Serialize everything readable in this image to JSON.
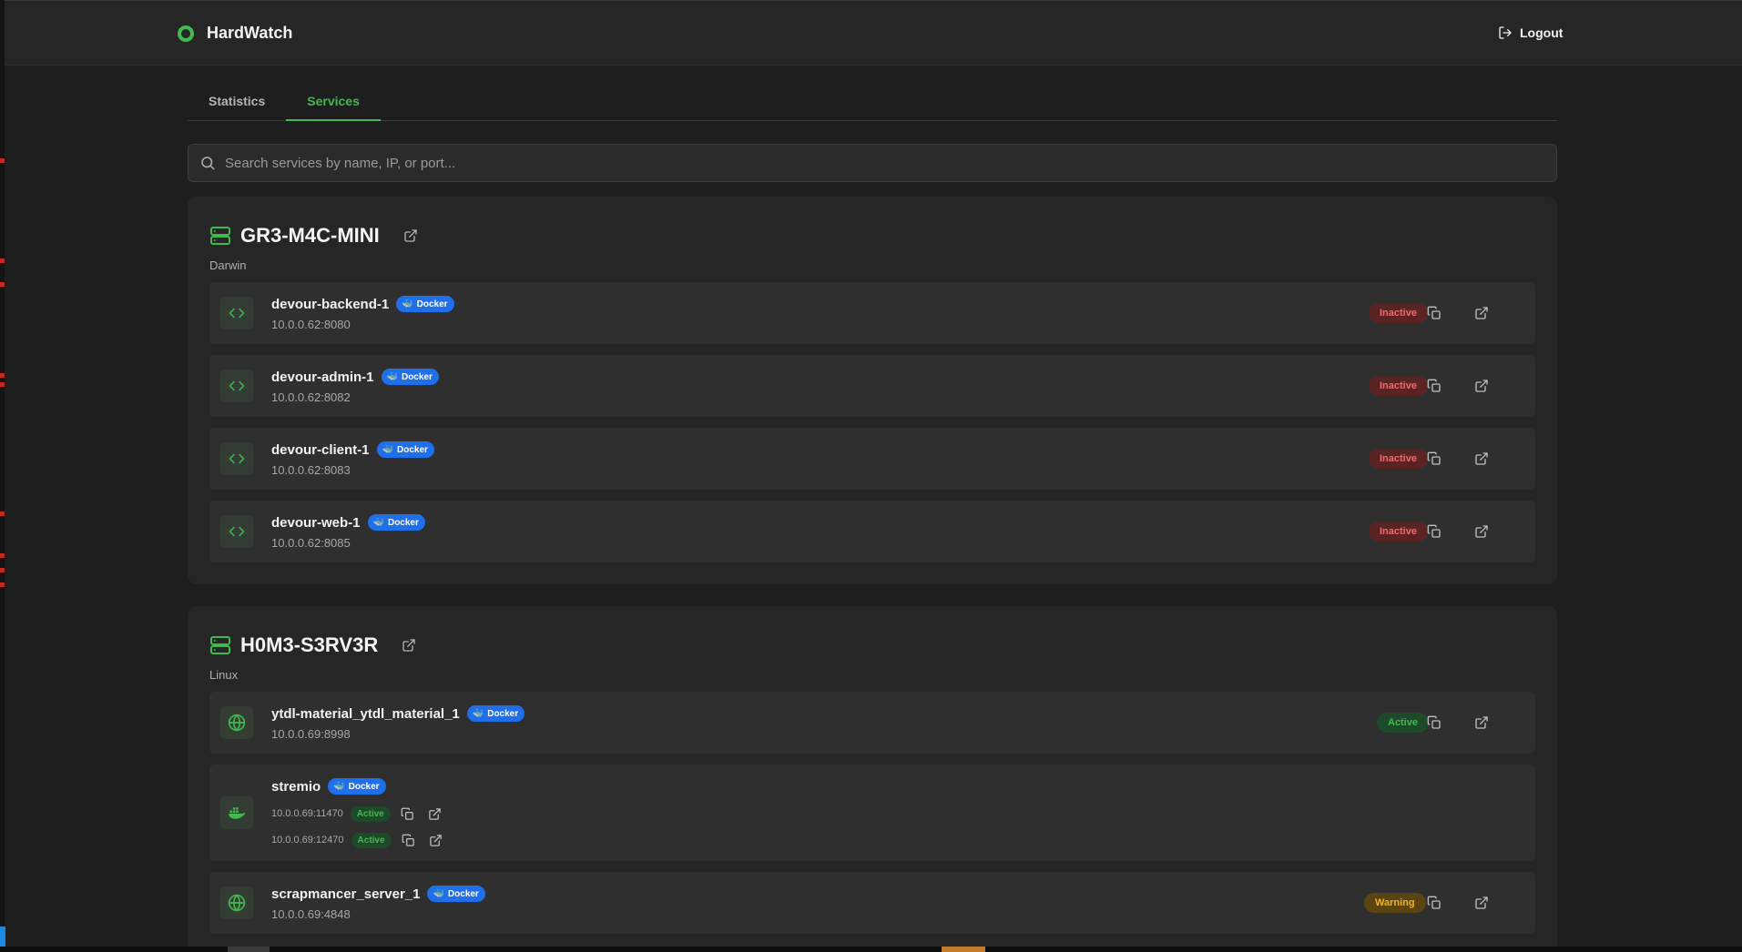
{
  "app": {
    "name": "HardWatch",
    "logout_label": "Logout"
  },
  "tabs": [
    {
      "label": "Statistics",
      "active": false
    },
    {
      "label": "Services",
      "active": true
    }
  ],
  "search": {
    "placeholder": "Search services by name, IP, or port...",
    "value": ""
  },
  "colors": {
    "accent": "#3fb950",
    "docker_badge": "#1f6feb",
    "inactive": "#f26a6a",
    "warning": "#f0b429"
  },
  "hosts": [
    {
      "name": "GR3-M4C-MINI",
      "os": "Darwin",
      "services": [
        {
          "name": "devour-backend-1",
          "badge": "Docker",
          "address": "10.0.0.62:8080",
          "status": "Inactive",
          "icon": "code-icon"
        },
        {
          "name": "devour-admin-1",
          "badge": "Docker",
          "address": "10.0.0.62:8082",
          "status": "Inactive",
          "icon": "code-icon"
        },
        {
          "name": "devour-client-1",
          "badge": "Docker",
          "address": "10.0.0.62:8083",
          "status": "Inactive",
          "icon": "code-icon"
        },
        {
          "name": "devour-web-1",
          "badge": "Docker",
          "address": "10.0.0.62:8085",
          "status": "Inactive",
          "icon": "code-icon"
        }
      ]
    },
    {
      "name": "H0M3-S3RV3R",
      "os": "Linux",
      "services": [
        {
          "name": "ytdl-material_ytdl_material_1",
          "badge": "Docker",
          "address": "10.0.0.69:8998",
          "status": "Active",
          "icon": "globe-icon"
        },
        {
          "name": "stremio",
          "badge": "Docker",
          "icon": "docker-icon",
          "ports": [
            {
              "address": "10.0.0.69:11470",
              "status": "Active"
            },
            {
              "address": "10.0.0.69:12470",
              "status": "Active"
            }
          ]
        },
        {
          "name": "scrapmancer_server_1",
          "badge": "Docker",
          "address": "10.0.0.69:4848",
          "status": "Warning",
          "icon": "globe-icon"
        }
      ]
    }
  ]
}
